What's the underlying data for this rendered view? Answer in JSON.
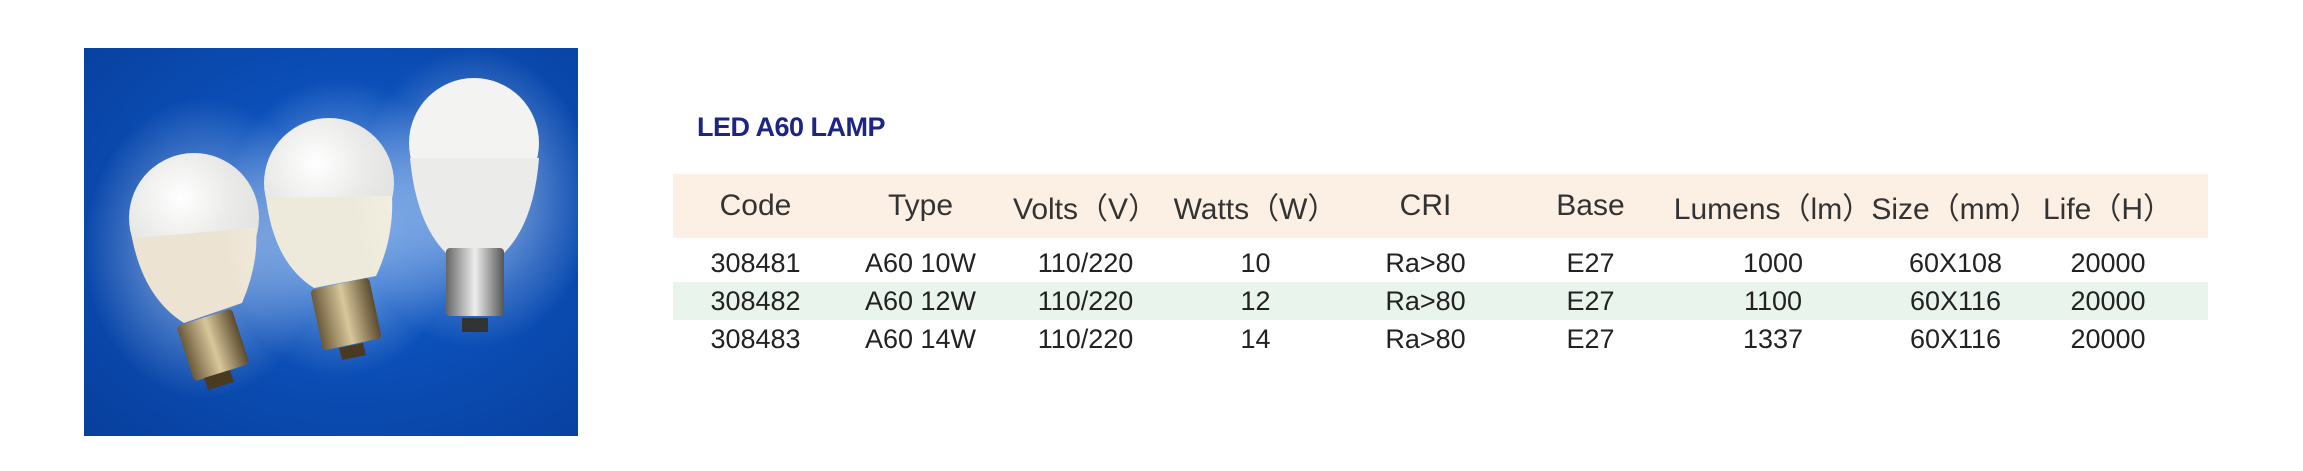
{
  "product_title": "LED A60 LAMP",
  "table": {
    "headers": [
      "Code",
      "Type",
      "Volts（V）",
      "Watts（W）",
      "CRI",
      "Base",
      "Lumens（lm）",
      "Size（mm）",
      "Life（H）"
    ],
    "rows": [
      [
        "308481",
        "A60 10W",
        "110/220",
        "10",
        "Ra>80",
        "E27",
        "1000",
        "60X108",
        "20000"
      ],
      [
        "308482",
        "A60 12W",
        "110/220",
        "12",
        "Ra>80",
        "E27",
        "1100",
        "60X116",
        "20000"
      ],
      [
        "308483",
        "A60 14W",
        "110/220",
        "14",
        "Ra>80",
        "E27",
        "1337",
        "60X116",
        "20000"
      ]
    ]
  },
  "colors": {
    "title": "#1c2585",
    "header_bg": "#fcefe3",
    "shaded_row_bg": "#e8f4ec",
    "photo_bg": "#0b4fb8"
  }
}
